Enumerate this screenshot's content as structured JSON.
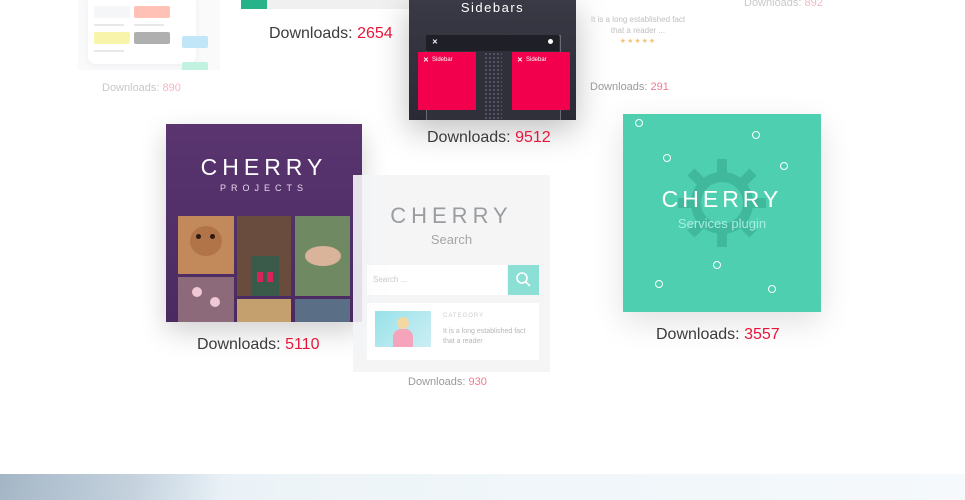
{
  "downloads_prefix": "Downloads:",
  "items": [
    {
      "name": "palette-plugin",
      "downloads": "890"
    },
    {
      "name": "top-plugin",
      "downloads": "2654"
    },
    {
      "name": "cherry-sidebars",
      "title": "Sidebars",
      "sidebar_label": "Sidebar",
      "downloads": "9512"
    },
    {
      "name": "review-plugin",
      "review_text": "It is a long established fact that a reader ...",
      "stars": "★★★★★",
      "downloads": "291"
    },
    {
      "name": "top-right-plugin",
      "downloads": "892"
    },
    {
      "name": "cherry-projects",
      "title": "CHERRY",
      "subtitle": "PROJECTS",
      "downloads": "5110"
    },
    {
      "name": "cherry-search",
      "title": "CHERRY",
      "subtitle": "Search",
      "search_placeholder": "Search ...",
      "result_category": "CATEGORY",
      "result_text": "It is a long established fact that a reader",
      "downloads": "930"
    },
    {
      "name": "cherry-services",
      "title": "CHERRY",
      "subtitle": "Services plugin",
      "downloads": "3557"
    }
  ],
  "colors": {
    "accent": "#e8153a",
    "sidebars_pink": "#f2004e",
    "services_green": "#4ecfb0",
    "projects_purple": "#5a3570",
    "search_button": "#7fdcd0"
  }
}
